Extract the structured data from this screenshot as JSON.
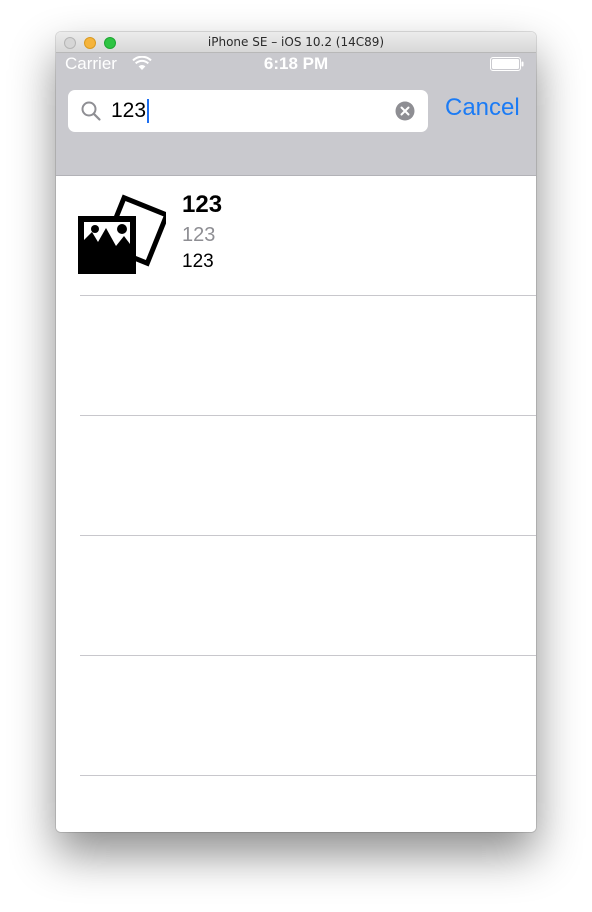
{
  "window": {
    "title": "iPhone SE – iOS 10.2 (14C89)"
  },
  "status_bar": {
    "carrier": "Carrier",
    "time": "6:18 PM",
    "wifi_icon": "wifi-icon",
    "battery_icon": "battery-icon"
  },
  "search": {
    "value": "123",
    "search_icon": "search-icon",
    "clear_icon": "clear-icon",
    "cancel_label": "Cancel"
  },
  "results": [
    {
      "icon": "photos-icon",
      "title": "123",
      "subtitle": "123",
      "detail": "123"
    }
  ],
  "colors": {
    "accent": "#1b7bf5",
    "header_background": "#c9c9ce",
    "separator": "#c8c7cc",
    "subtitle_text": "#8e8e93"
  }
}
